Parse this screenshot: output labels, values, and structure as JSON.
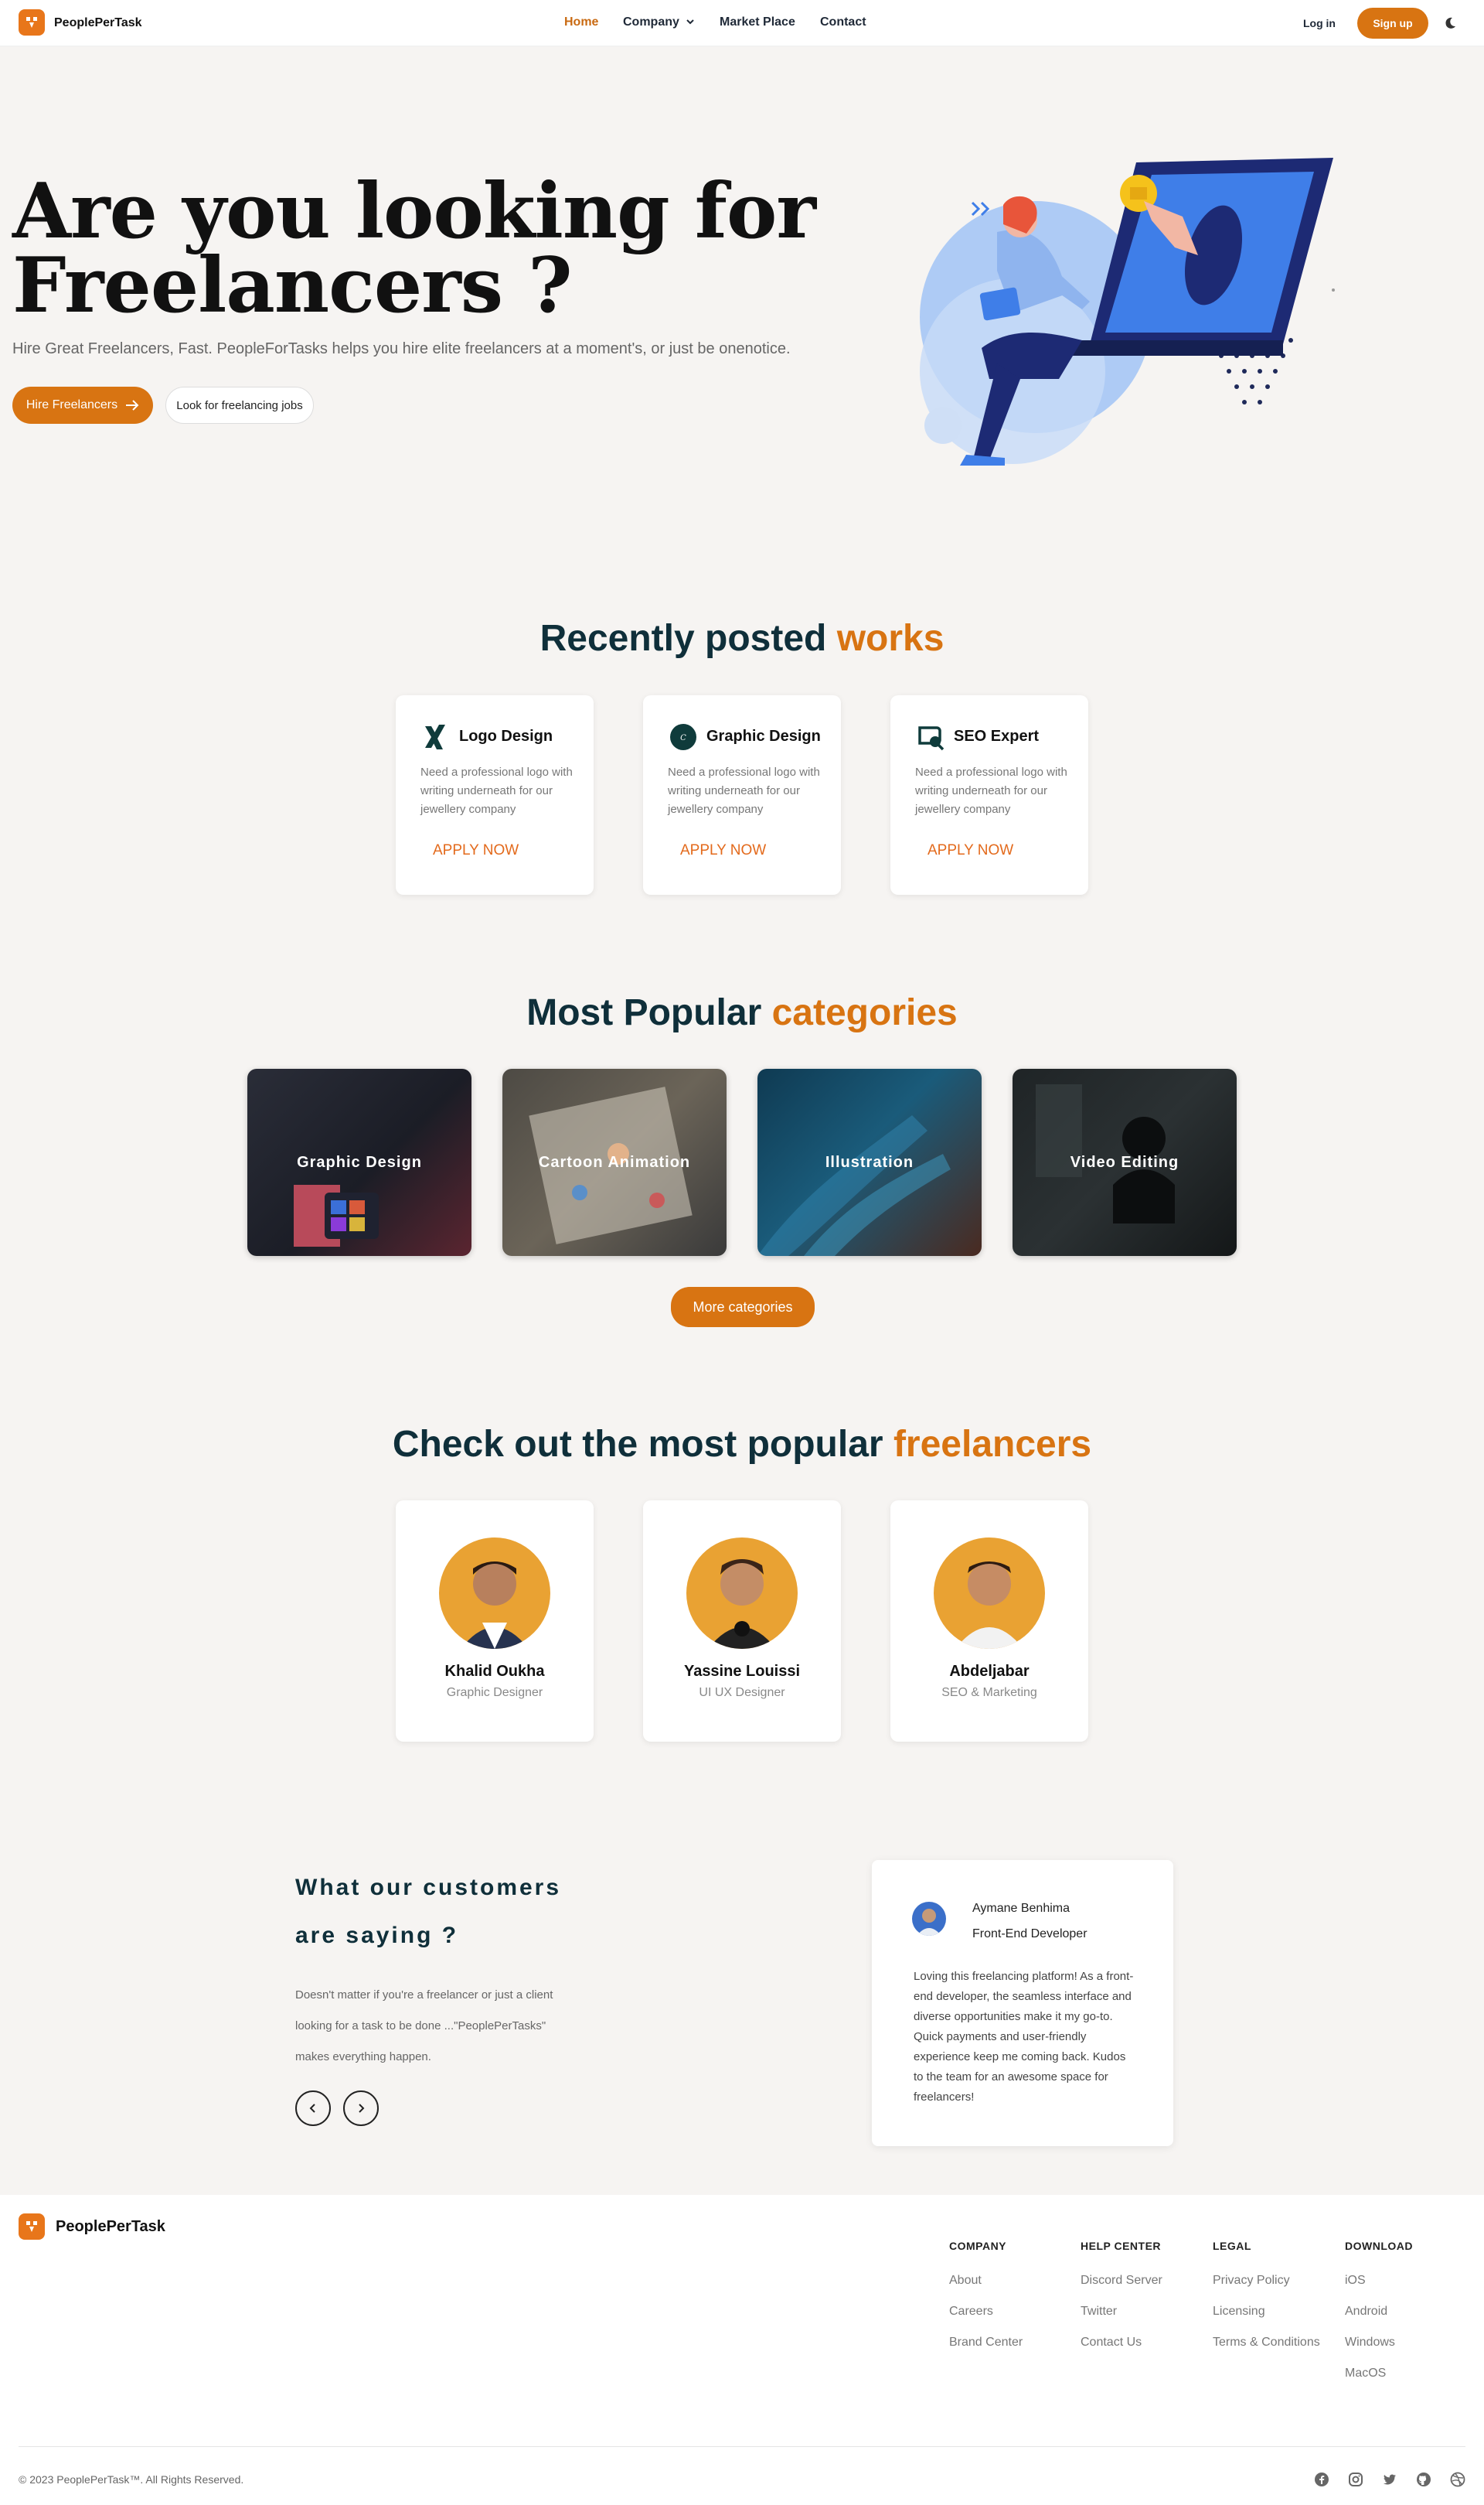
{
  "brand": {
    "name": "PeoplePerTask"
  },
  "nav": {
    "links": [
      "Home",
      "Company",
      "Market Place",
      "Contact"
    ],
    "login": "Log in",
    "signup": "Sign up"
  },
  "hero": {
    "title_line1": "Are you looking for",
    "title_line2": "Freelancers ?",
    "subtitle": "Hire Great Freelancers, Fast. PeopleForTasks helps you hire elite freelancers at a moment's, or just be onenotice.",
    "hire_button": "Hire Freelancers",
    "jobs_button": "Look for freelancing jobs"
  },
  "works": {
    "title": "Recently posted",
    "title_accent": "works",
    "items": [
      {
        "title": "Logo Design",
        "desc": "Need a professional logo with writing underneath for our jewellery company",
        "cta": "APPLY NOW",
        "icon": "xing-icon"
      },
      {
        "title": "Graphic Design",
        "desc": "Need a professional logo with writing underneath for our jewellery company",
        "cta": "APPLY NOW",
        "icon": "canva-icon"
      },
      {
        "title": "SEO Expert",
        "desc": "Need a professional logo with writing underneath for our jewellery company",
        "cta": "APPLY NOW",
        "icon": "seo-icon"
      }
    ]
  },
  "categories": {
    "title": "Most Popular",
    "title_accent": "categories",
    "items": [
      "Graphic Design",
      "Cartoon Animation",
      "Illustration",
      "Video Editing"
    ],
    "more_button": "More categories"
  },
  "freelancers": {
    "title": "Check out the most popular",
    "title_accent": "freelancers",
    "items": [
      {
        "name": "Khalid Oukha",
        "role": "Graphic Designer"
      },
      {
        "name": "Yassine Louissi",
        "role": "UI UX Designer"
      },
      {
        "name": "Abdeljabar",
        "role": "SEO & Marketing"
      }
    ]
  },
  "testimonials": {
    "title_line1": "What our customers",
    "title_line2": "are saying ?",
    "intro": "Doesn't matter if you're a freelancer or just a client looking for a task to be done ...\"PeoplePerTasks\" makes everything happen.",
    "author": "Aymane Benhima",
    "author_role": "Front-End Developer",
    "quote": "Loving this freelancing platform! As a front-end developer, the seamless interface and diverse opportunities make it my go-to. Quick payments and user-friendly experience keep me coming back. Kudos to the team for an awesome space for freelancers!"
  },
  "footer": {
    "columns": [
      {
        "heading": "COMPANY",
        "links": [
          "About",
          "Careers",
          "Brand Center"
        ]
      },
      {
        "heading": "HELP CENTER",
        "links": [
          "Discord Server",
          "Twitter",
          "Contact Us"
        ]
      },
      {
        "heading": "LEGAL",
        "links": [
          "Privacy Policy",
          "Licensing",
          "Terms & Conditions"
        ]
      },
      {
        "heading": "DOWNLOAD",
        "links": [
          "iOS",
          "Android",
          "Windows",
          "MacOS"
        ]
      }
    ],
    "copyright": "© 2023 PeoplePerTask™. All Rights Reserved.",
    "social_icons": [
      "facebook-icon",
      "instagram-icon",
      "twitter-icon",
      "github-icon",
      "dribbble-icon"
    ]
  },
  "colors": {
    "accent": "#d87412",
    "navy": "#0f2f3a",
    "background": "#f6f4f2"
  }
}
